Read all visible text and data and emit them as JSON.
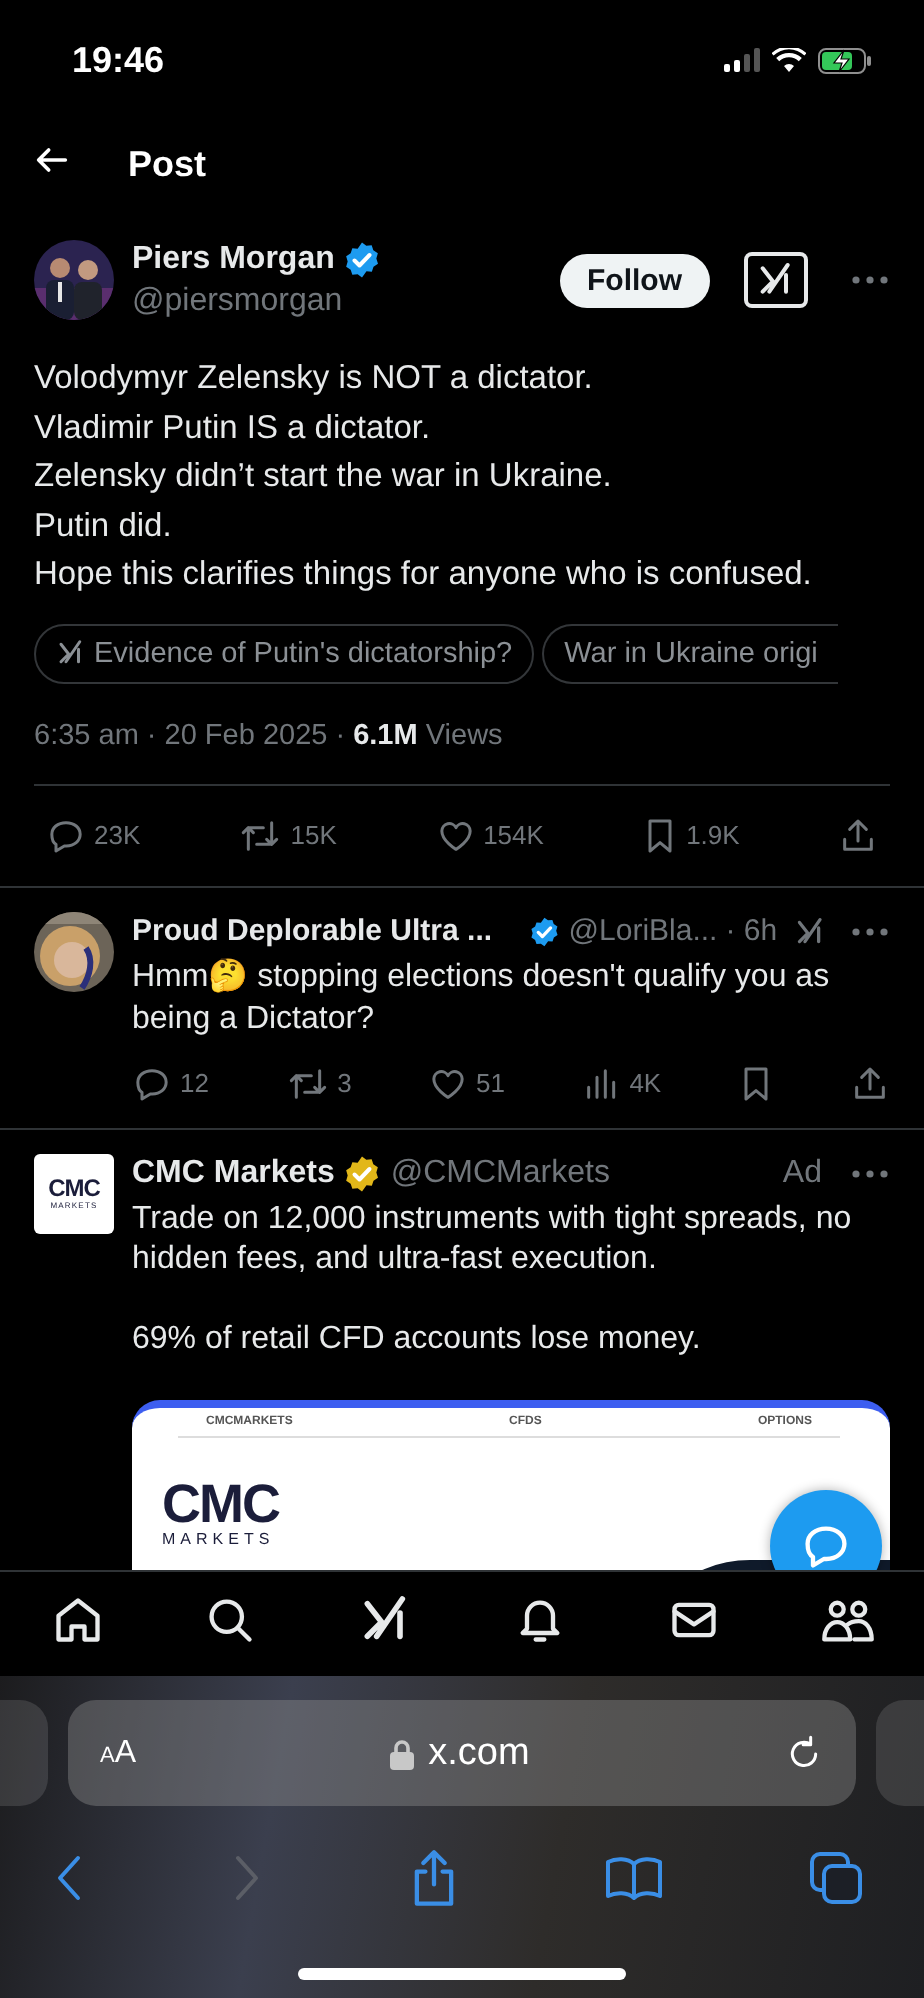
{
  "status_bar": {
    "time": "19:46",
    "battery_charging": true
  },
  "header": {
    "title": "Post"
  },
  "post": {
    "author": {
      "name": "Piers Morgan",
      "handle": "@piersmorgan",
      "badge": {
        "color": "#1d9bf0"
      }
    },
    "follow_label": "Follow",
    "lines": [
      "Volodymyr Zelensky is NOT a dictator.",
      "Vladimir Putin IS a dictator.",
      "Zelensky didn’t start the war in Ukraine.",
      "Putin did.",
      "Hope this clarifies things for anyone who is confused."
    ],
    "chips": [
      {
        "kind": "grok",
        "label": "Evidence of Putin's dictatorship?"
      },
      {
        "kind": "plain",
        "label": "War in Ukraine origi"
      }
    ],
    "meta": "6:35 am · 20 Feb 2025 · **6.1M** Views",
    "actions": [
      {
        "kind": "reply",
        "count": "23K"
      },
      {
        "kind": "repost",
        "count": "15K"
      },
      {
        "kind": "like",
        "count": "154K"
      },
      {
        "kind": "bookmark",
        "count": "1.9K"
      },
      {
        "kind": "share"
      }
    ]
  },
  "reply": {
    "author": {
      "name": "Proud Deplorable Ultra ...",
      "handle": "@LoriBla...",
      "badge": {
        "color": "#1d9bf0"
      }
    },
    "age": "· 6h",
    "text": "Hmm🤔  stopping elections doesn't qualify you as being a Dictator?",
    "actions": [
      {
        "kind": "reply",
        "count": "12"
      },
      {
        "kind": "repost",
        "count": "3"
      },
      {
        "kind": "like",
        "count": "51"
      },
      {
        "kind": "views",
        "count": "4K"
      },
      {
        "kind": "bookmark"
      },
      {
        "kind": "share"
      }
    ]
  },
  "ad": {
    "author": {
      "name": "CMC Markets",
      "handle": "@CMCMarkets",
      "badge": {
        "color": "#e2b719"
      }
    },
    "logo": {
      "mark": "CMC",
      "sub": "MARKETS"
    },
    "label": "Ad",
    "paragraphs": [
      "Trade on 12,000 instruments with tight spreads, no hidden fees, and ultra-fast execution.",
      "69% of retail CFD accounts lose money."
    ],
    "card": {
      "nav": [
        "CMCMARKETS",
        "CFDS",
        "OPTIONS"
      ],
      "logo_mark": "CMC",
      "logo_sub": "MARKETS"
    }
  },
  "tab_bar": {
    "items": [
      {
        "kind": "home"
      },
      {
        "kind": "search"
      },
      {
        "kind": "grok"
      },
      {
        "kind": "notifications"
      },
      {
        "kind": "messages"
      },
      {
        "kind": "communities"
      }
    ]
  },
  "browser": {
    "text_size": "AA",
    "url": "x.com",
    "toolbar": [
      {
        "kind": "back",
        "disabled": false
      },
      {
        "kind": "forward",
        "disabled": true
      },
      {
        "kind": "share",
        "disabled": false
      },
      {
        "kind": "bookmarks",
        "disabled": false
      },
      {
        "kind": "tabs",
        "disabled": false
      }
    ]
  }
}
